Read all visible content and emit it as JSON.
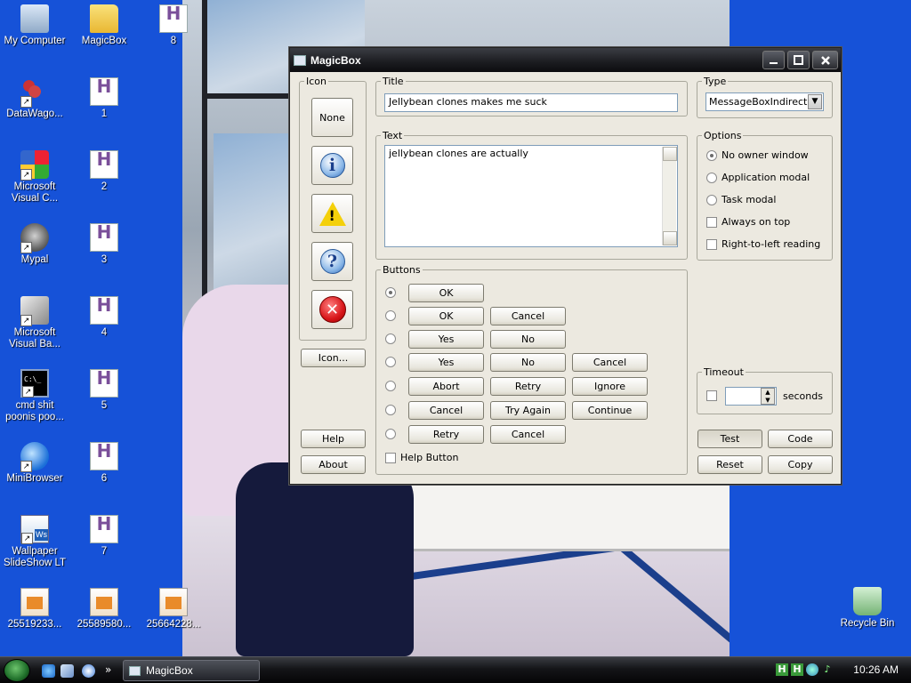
{
  "desktop": {
    "icons_col1": [
      {
        "label": "My Computer",
        "icon": "computer-icon"
      },
      {
        "label": "DataWago...",
        "icon": "datawagon-icon"
      },
      {
        "label": "Microsoft Visual C...",
        "icon": "visual-c-icon"
      },
      {
        "label": "Mypal",
        "icon": "mypal-icon"
      },
      {
        "label": "Microsoft Visual Ba...",
        "icon": "visual-basic-icon"
      },
      {
        "label": "cmd shit poonis poo...",
        "icon": "console-icon"
      },
      {
        "label": "MiniBrowser",
        "icon": "minibrowser-icon"
      },
      {
        "label": "Wallpaper SlideShow LT",
        "icon": "wallpaper-slideshow-icon"
      },
      {
        "label": "25519233...",
        "icon": "image-file-icon"
      }
    ],
    "icons_col2": [
      {
        "label": "MagicBox",
        "icon": "folder-icon"
      },
      {
        "label": "1",
        "icon": "h-file-icon"
      },
      {
        "label": "2",
        "icon": "h-file-icon"
      },
      {
        "label": "3",
        "icon": "h-file-icon"
      },
      {
        "label": "4",
        "icon": "h-file-icon"
      },
      {
        "label": "5",
        "icon": "h-file-icon"
      },
      {
        "label": "6",
        "icon": "h-file-icon"
      },
      {
        "label": "7",
        "icon": "h-file-icon"
      },
      {
        "label": "25589580...",
        "icon": "image-file-icon"
      }
    ],
    "icons_col3": [
      {
        "label": "8",
        "icon": "h-file-icon"
      },
      {
        "label": "25664228...",
        "icon": "image-file-icon"
      }
    ],
    "recycle_bin": "Recycle Bin"
  },
  "window": {
    "title": "MagicBox",
    "icon_group": {
      "legend": "Icon",
      "none_label": "None",
      "icons": [
        "information-icon",
        "warning-icon",
        "question-icon",
        "error-icon"
      ],
      "icon_button": "Icon..."
    },
    "help_button": "Help",
    "about_button": "About",
    "title_group": {
      "legend": "Title",
      "value": "Jellybean clones makes me suck"
    },
    "text_group": {
      "legend": "Text",
      "value": "jellybean clones are actually"
    },
    "type_group": {
      "legend": "Type",
      "selected": "MessageBoxIndirect"
    },
    "options_group": {
      "legend": "Options",
      "items": [
        {
          "label": "No owner window",
          "kind": "radio",
          "checked": true
        },
        {
          "label": "Application modal",
          "kind": "radio",
          "checked": false
        },
        {
          "label": "Task modal",
          "kind": "radio",
          "checked": false
        },
        {
          "label": "Always on top",
          "kind": "checkbox",
          "checked": false
        },
        {
          "label": "Right-to-left reading",
          "kind": "checkbox",
          "checked": false
        }
      ]
    },
    "buttons_group": {
      "legend": "Buttons",
      "rows": [
        {
          "selected": true,
          "buttons": [
            "OK"
          ]
        },
        {
          "selected": false,
          "buttons": [
            "OK",
            "Cancel"
          ]
        },
        {
          "selected": false,
          "buttons": [
            "Yes",
            "No"
          ]
        },
        {
          "selected": false,
          "buttons": [
            "Yes",
            "No",
            "Cancel"
          ]
        },
        {
          "selected": false,
          "buttons": [
            "Abort",
            "Retry",
            "Ignore"
          ]
        },
        {
          "selected": false,
          "buttons": [
            "Cancel",
            "Try Again",
            "Continue"
          ]
        },
        {
          "selected": false,
          "buttons": [
            "Retry",
            "Cancel"
          ]
        }
      ],
      "help_button_label": "Help Button"
    },
    "timeout_group": {
      "legend": "Timeout",
      "value": "",
      "unit": "seconds"
    },
    "actions": {
      "test": "Test",
      "code": "Code",
      "reset": "Reset",
      "copy": "Copy"
    }
  },
  "taskbar": {
    "task_label": "MagicBox",
    "clock": "10:26 AM",
    "quicklaunch_more": "»"
  }
}
